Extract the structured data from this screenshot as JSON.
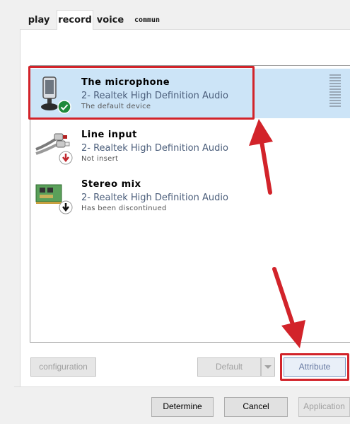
{
  "tabs": [
    {
      "label": "play",
      "active": false
    },
    {
      "label": "record",
      "active": true
    },
    {
      "label": "voice",
      "active": false
    },
    {
      "label": "commun",
      "active": false
    }
  ],
  "devices": [
    {
      "name": "The microphone",
      "driver": "2- Realtek High Definition Audio",
      "status": "The default device",
      "icon": "microphone-icon",
      "badge": "green-check-badge",
      "selected": true
    },
    {
      "name": "Line input",
      "driver": "2- Realtek High Definition Audio",
      "status": "Not insert",
      "icon": "line-input-cable-icon",
      "badge": "red-down-arrow-badge",
      "selected": false
    },
    {
      "name": "Stereo mix",
      "driver": "2- Realtek High Definition Audio",
      "status": "Has been discontinued",
      "icon": "sound-card-icon",
      "badge": "black-down-arrow-badge",
      "selected": false
    }
  ],
  "buttons": {
    "configuration": "configuration",
    "default": "Default",
    "attribute": "Attribute",
    "determine": "Determine",
    "cancel": "Cancel",
    "application": "Application"
  },
  "colors": {
    "annotation": "#d2232a",
    "selection": "#cce4f7",
    "check": "#1f8a3b"
  }
}
